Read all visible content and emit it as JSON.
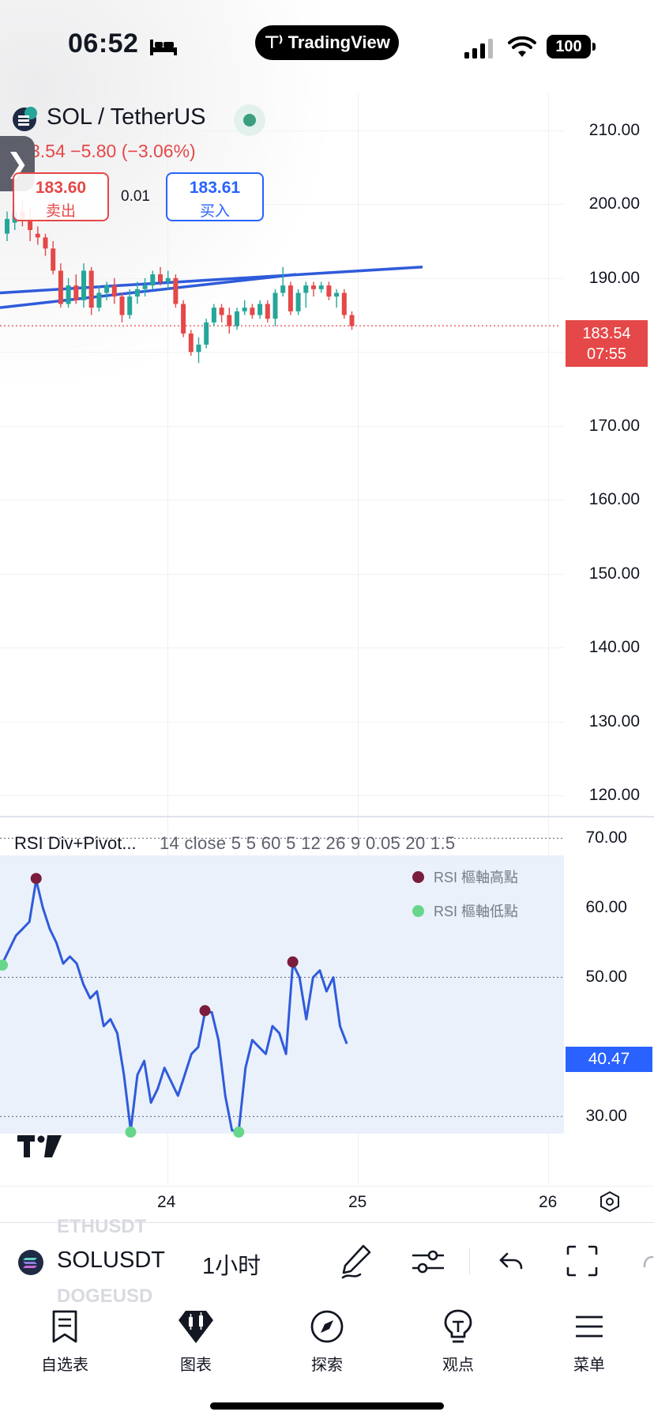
{
  "status_bar": {
    "time": "06:52",
    "app_pill": "TradingView",
    "battery": "100"
  },
  "symbol": {
    "title": "SOL / TetherUS",
    "change": "3.54  −5.80 (−3.06%)",
    "sell_price": "183.60",
    "sell_label": "卖出",
    "spread": "0.01",
    "buy_price": "183.61",
    "buy_label": "买入"
  },
  "price_axis": {
    "labels": [
      "210.00",
      "200.00",
      "190.00",
      "180.00",
      "170.00",
      "160.00",
      "150.00",
      "140.00",
      "130.00",
      "120.00"
    ],
    "last_price": "183.54",
    "countdown": "07:55"
  },
  "rsi_pane": {
    "title": "RSI Div+Pivot...",
    "params": "14 close 5 5 60 5 12 26 9 0.05 20 1.5",
    "legend": [
      {
        "label": "RSI 樞軸高點",
        "color": "#7b1c3c"
      },
      {
        "label": "RSI 樞軸低點",
        "color": "#66d68a"
      }
    ],
    "axis_labels": [
      "70.00",
      "60.00",
      "50.00",
      "40.00",
      "30.00"
    ],
    "current_value": "40.47"
  },
  "time_axis": {
    "labels": [
      "24",
      "25",
      "26"
    ]
  },
  "toolbar": {
    "symbol": "SOLUSDT",
    "interval": "1小时",
    "ghost_above": "ETHUSDT",
    "ghost_below": "DOGEUSD"
  },
  "tab_bar": {
    "items": [
      {
        "label": "自选表"
      },
      {
        "label": "图表"
      },
      {
        "label": "探索"
      },
      {
        "label": "观点"
      },
      {
        "label": "菜单"
      }
    ]
  },
  "colors": {
    "bull": "#26a69a",
    "bear": "#e54848",
    "rsi_line": "#2f5bdb",
    "trendline": "#2f5bdb",
    "accent": "#2962ff"
  },
  "chart_data": {
    "type": "candlestick",
    "title": "SOL / TetherUS",
    "y_range": [
      115,
      215
    ],
    "x_ticks": [
      "24",
      "25",
      "26"
    ],
    "candles": [
      {
        "o": 196.0,
        "h": 199.0,
        "c": 198.0,
        "l": 195.0
      },
      {
        "o": 197.5,
        "h": 200.0,
        "c": 199.0,
        "l": 196.5
      },
      {
        "o": 199.0,
        "h": 200.5,
        "c": 198.0,
        "l": 197.0
      },
      {
        "o": 198.0,
        "h": 199.5,
        "c": 196.5,
        "l": 195.0
      },
      {
        "o": 196.0,
        "h": 197.0,
        "c": 195.5,
        "l": 194.5
      },
      {
        "o": 195.5,
        "h": 196.0,
        "c": 194.0,
        "l": 193.0
      },
      {
        "o": 194.0,
        "h": 195.0,
        "c": 191.0,
        "l": 190.5
      },
      {
        "o": 191.0,
        "h": 192.0,
        "c": 186.5,
        "l": 186.0
      },
      {
        "o": 186.5,
        "h": 190.0,
        "c": 189.0,
        "l": 186.0
      },
      {
        "o": 189.0,
        "h": 190.5,
        "c": 187.0,
        "l": 186.5
      },
      {
        "o": 187.0,
        "h": 192.0,
        "c": 191.0,
        "l": 186.0
      },
      {
        "o": 191.0,
        "h": 191.5,
        "c": 186.0,
        "l": 185.0
      },
      {
        "o": 186.0,
        "h": 189.0,
        "c": 188.0,
        "l": 185.5
      },
      {
        "o": 188.0,
        "h": 189.5,
        "c": 189.0,
        "l": 187.0
      },
      {
        "o": 189.0,
        "h": 190.0,
        "c": 187.5,
        "l": 186.5
      },
      {
        "o": 187.5,
        "h": 188.0,
        "c": 185.0,
        "l": 184.0
      },
      {
        "o": 185.0,
        "h": 188.5,
        "c": 187.5,
        "l": 184.5
      },
      {
        "o": 187.5,
        "h": 189.5,
        "c": 188.5,
        "l": 186.5
      },
      {
        "o": 188.5,
        "h": 190.0,
        "c": 189.0,
        "l": 187.5
      },
      {
        "o": 189.0,
        "h": 191.0,
        "c": 190.5,
        "l": 188.5
      },
      {
        "o": 190.5,
        "h": 191.5,
        "c": 189.5,
        "l": 189.0
      },
      {
        "o": 189.5,
        "h": 191.0,
        "c": 190.0,
        "l": 188.5
      },
      {
        "o": 190.0,
        "h": 190.5,
        "c": 186.5,
        "l": 186.0
      },
      {
        "o": 186.5,
        "h": 187.0,
        "c": 182.5,
        "l": 182.0
      },
      {
        "o": 182.5,
        "h": 183.0,
        "c": 180.0,
        "l": 179.5
      },
      {
        "o": 180.0,
        "h": 182.0,
        "c": 181.0,
        "l": 178.5
      },
      {
        "o": 181.0,
        "h": 184.5,
        "c": 184.0,
        "l": 180.5
      },
      {
        "o": 184.0,
        "h": 186.5,
        "c": 186.0,
        "l": 183.5
      },
      {
        "o": 186.0,
        "h": 186.5,
        "c": 185.0,
        "l": 184.0
      },
      {
        "o": 185.0,
        "h": 186.0,
        "c": 183.5,
        "l": 182.5
      },
      {
        "o": 183.5,
        "h": 186.0,
        "c": 185.5,
        "l": 183.0
      },
      {
        "o": 185.5,
        "h": 187.0,
        "c": 186.0,
        "l": 185.0
      },
      {
        "o": 186.0,
        "h": 186.5,
        "c": 185.0,
        "l": 184.5
      },
      {
        "o": 185.0,
        "h": 187.0,
        "c": 186.5,
        "l": 184.5
      },
      {
        "o": 186.5,
        "h": 187.0,
        "c": 184.5,
        "l": 184.0
      },
      {
        "o": 184.5,
        "h": 188.5,
        "c": 188.0,
        "l": 183.5
      },
      {
        "o": 188.0,
        "h": 191.5,
        "c": 189.0,
        "l": 187.5
      },
      {
        "o": 189.0,
        "h": 189.5,
        "c": 185.5,
        "l": 185.0
      },
      {
        "o": 185.5,
        "h": 188.5,
        "c": 188.0,
        "l": 185.0
      },
      {
        "o": 188.0,
        "h": 189.5,
        "c": 189.0,
        "l": 186.0
      },
      {
        "o": 189.0,
        "h": 189.5,
        "c": 188.5,
        "l": 187.5
      },
      {
        "o": 188.5,
        "h": 189.5,
        "c": 189.0,
        "l": 188.0
      },
      {
        "o": 189.0,
        "h": 189.5,
        "c": 187.5,
        "l": 187.0
      },
      {
        "o": 187.5,
        "h": 188.5,
        "c": 188.0,
        "l": 186.0
      },
      {
        "o": 188.0,
        "h": 188.5,
        "c": 185.0,
        "l": 184.5
      },
      {
        "o": 185.0,
        "h": 185.5,
        "c": 183.5,
        "l": 183.0
      }
    ],
    "trendlines": [
      {
        "from": 186.0,
        "to": 190.5
      },
      {
        "from": 188.0,
        "to": 191.5
      }
    ],
    "rsi": {
      "y_range": [
        23,
        73
      ],
      "levels": [
        70,
        50,
        30
      ],
      "values": [
        52,
        54,
        56,
        57,
        58,
        64,
        60,
        57,
        55,
        52,
        53,
        52,
        49,
        47,
        48,
        43,
        44,
        42,
        36,
        28,
        36,
        38,
        32,
        34,
        37,
        35,
        33,
        36,
        39,
        40,
        45,
        45,
        41,
        33,
        28,
        28,
        37,
        41,
        40,
        39,
        43,
        42,
        39,
        52,
        50,
        44,
        50,
        51,
        48,
        50,
        43,
        40.47
      ],
      "pivot_highs": [
        5,
        30,
        43
      ],
      "pivot_lows": [
        0,
        19,
        35
      ]
    }
  }
}
